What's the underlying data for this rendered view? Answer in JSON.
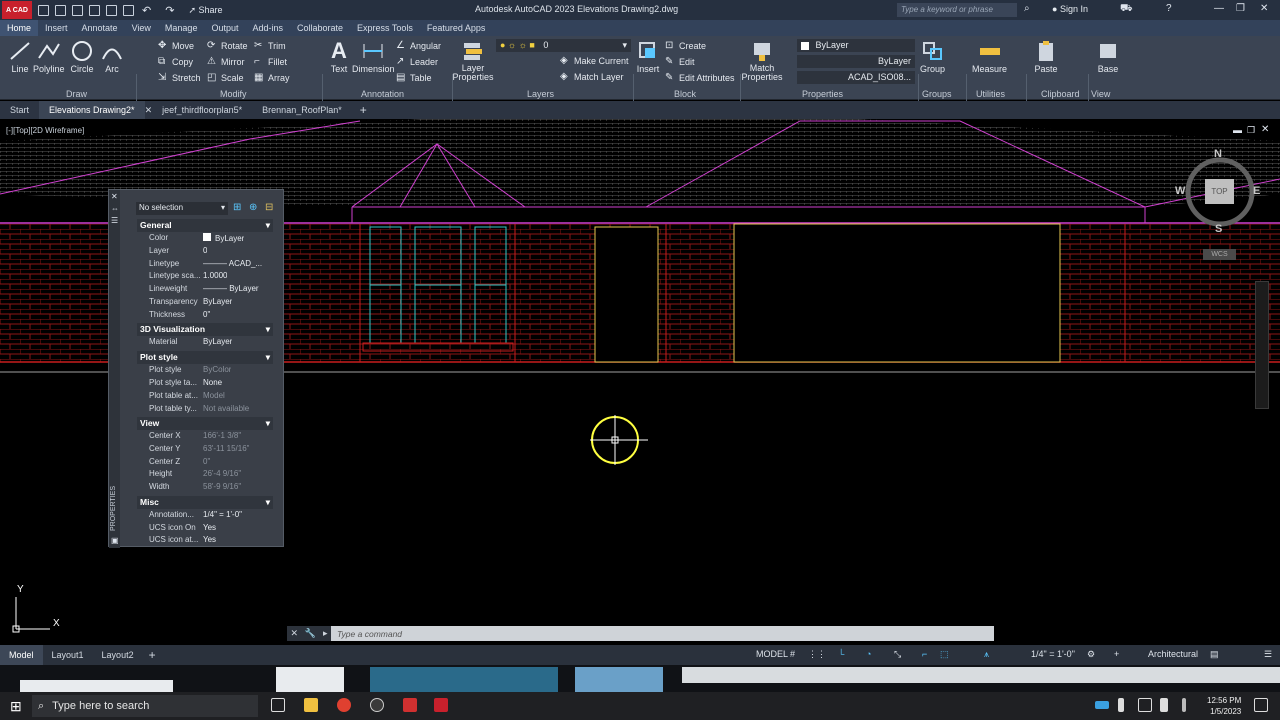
{
  "app": {
    "logo_text": "A CAD",
    "title": "Autodesk AutoCAD 2023   Elevations Drawing2.dwg",
    "share_label": "Share",
    "search_placeholder": "Type a keyword or phrase",
    "signin_label": "Sign In"
  },
  "ribbon_tabs": [
    "Home",
    "Insert",
    "Annotate",
    "View",
    "Manage",
    "Output",
    "Add-ins",
    "Collaborate",
    "Express Tools",
    "Featured Apps"
  ],
  "ribbon": {
    "draw": {
      "line": "Line",
      "polyline": "Polyline",
      "circle": "Circle",
      "arc": "Arc",
      "title": "Draw"
    },
    "modify": {
      "move": "Move",
      "rotate": "Rotate",
      "trim": "Trim",
      "copy": "Copy",
      "mirror": "Mirror",
      "fillet": "Fillet",
      "stretch": "Stretch",
      "scale": "Scale",
      "array": "Array",
      "title": "Modify"
    },
    "annotation": {
      "text": "Text",
      "dimension": "Dimension",
      "angular": "Angular",
      "leader": "Leader",
      "table": "Table",
      "title": "Annotation"
    },
    "layers": {
      "layer_properties": "Layer Properties",
      "layer_value": "0",
      "make_current": "Make Current",
      "match_layer": "Match Layer",
      "title": "Layers"
    },
    "block": {
      "insert": "Insert",
      "create": "Create",
      "edit": "Edit",
      "edit_attributes": "Edit Attributes",
      "title": "Block"
    },
    "properties": {
      "match": "Match Properties",
      "color": "ByLayer",
      "linetype": "ByLayer",
      "lineweight": "ACAD_ISO08...",
      "title": "Properties"
    },
    "groups": {
      "group": "Group",
      "title": "Groups"
    },
    "utilities": {
      "measure": "Measure",
      "title": "Utilities"
    },
    "clipboard": {
      "paste": "Paste",
      "title": "Clipboard"
    },
    "view": {
      "base": "Base",
      "title": "View"
    }
  },
  "doc_tabs": [
    "Start",
    "Elevations Drawing2*",
    "jeef_thirdfloorplan5*",
    "Brennan_RoofPlan*"
  ],
  "viewport": {
    "label": "[-][Top][2D Wireframe]"
  },
  "viewcube": {
    "n": "N",
    "s": "S",
    "e": "E",
    "w": "W",
    "top": "TOP",
    "wcs": "WCS"
  },
  "ucs": {
    "x": "X",
    "y": "Y"
  },
  "properties_palette": {
    "vertical_title": "PROPERTIES",
    "selection": "No selection",
    "sections": {
      "general": "General",
      "visualization": "3D Visualization",
      "plot_style": "Plot style",
      "view": "View",
      "misc": "Misc"
    },
    "general": [
      {
        "k": "Color",
        "v": "ByLayer"
      },
      {
        "k": "Layer",
        "v": "0"
      },
      {
        "k": "Linetype",
        "v": "——— ACAD_..."
      },
      {
        "k": "Linetype sca...",
        "v": "1.0000"
      },
      {
        "k": "Lineweight",
        "v": "——— ByLayer"
      },
      {
        "k": "Transparency",
        "v": "ByLayer"
      },
      {
        "k": "Thickness",
        "v": "0\""
      }
    ],
    "visualization": [
      {
        "k": "Material",
        "v": "ByLayer"
      }
    ],
    "plot_style": [
      {
        "k": "Plot style",
        "v": "ByColor"
      },
      {
        "k": "Plot style ta...",
        "v": "None"
      },
      {
        "k": "Plot table at...",
        "v": "Model"
      },
      {
        "k": "Plot table ty...",
        "v": "Not available"
      }
    ],
    "view": [
      {
        "k": "Center X",
        "v": "166'-1 3/8\""
      },
      {
        "k": "Center Y",
        "v": "63'-11 15/16\""
      },
      {
        "k": "Center Z",
        "v": "0\""
      },
      {
        "k": "Height",
        "v": "26'-4 9/16\""
      },
      {
        "k": "Width",
        "v": "58'-9 9/16\""
      }
    ],
    "misc": [
      {
        "k": "Annotation...",
        "v": "1/4\" = 1'-0\""
      },
      {
        "k": "UCS icon On",
        "v": "Yes"
      },
      {
        "k": "UCS icon at...",
        "v": "Yes"
      }
    ]
  },
  "command": {
    "placeholder": "Type a command"
  },
  "status": {
    "layout_tabs": [
      "Model",
      "Layout1",
      "Layout2"
    ],
    "model": "MODEL",
    "scale": "1/4\" = 1'-0\"",
    "units": "Architectural"
  },
  "taskbar": {
    "search_placeholder": "Type here to search",
    "time": "12:56 PM",
    "date": "1/5/2023"
  },
  "colors": {
    "brick": "#c81e1e",
    "roof": "#d040d0",
    "window": "#32c8c8",
    "door": "#e6c850",
    "cursor": "#ffff40"
  }
}
